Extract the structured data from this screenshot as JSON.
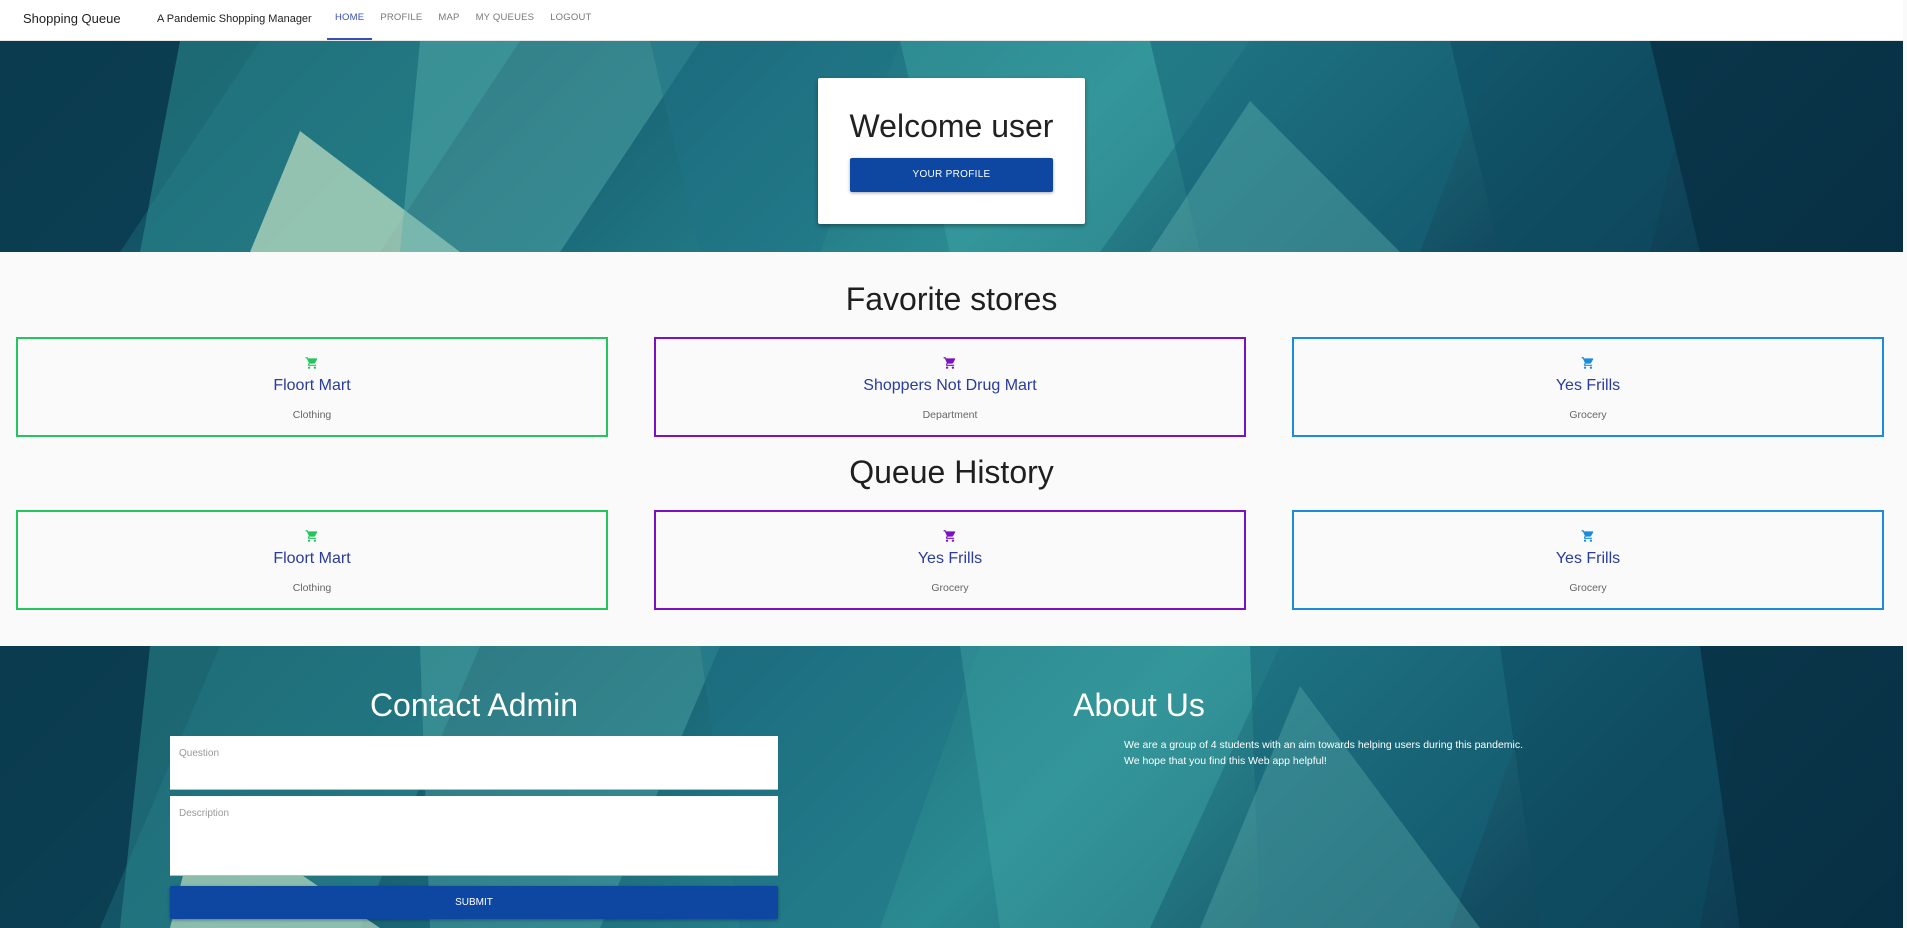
{
  "nav": {
    "brand": "Shopping Queue",
    "tagline": "A Pandemic Shopping Manager",
    "tabs": [
      {
        "label": "HOME",
        "active": true
      },
      {
        "label": "PROFILE",
        "active": false
      },
      {
        "label": "MAP",
        "active": false
      },
      {
        "label": "MY QUEUES",
        "active": false
      },
      {
        "label": "LOGOUT",
        "active": false
      }
    ]
  },
  "hero": {
    "welcome": "Welcome user",
    "profile_button": "YOUR PROFILE"
  },
  "favorites": {
    "title": "Favorite stores",
    "stores": [
      {
        "name": "Floort Mart",
        "category": "Clothing",
        "color": "#22c55e",
        "icon": "cart-icon"
      },
      {
        "name": "Shoppers Not Drug Mart",
        "category": "Department",
        "color": "#7a12c4",
        "icon": "cart-icon"
      },
      {
        "name": "Yes Frills",
        "category": "Grocery",
        "color": "#1a8cdb",
        "icon": "cart-icon"
      }
    ]
  },
  "history": {
    "title": "Queue History",
    "stores": [
      {
        "name": "Floort Mart",
        "category": "Clothing",
        "color": "#22c55e",
        "icon": "cart-icon"
      },
      {
        "name": "Yes Frills",
        "category": "Grocery",
        "color": "#7a12c4",
        "icon": "cart-icon"
      },
      {
        "name": "Yes Frills",
        "category": "Grocery",
        "color": "#1a8cdb",
        "icon": "cart-icon"
      }
    ]
  },
  "contact": {
    "title": "Contact Admin",
    "question_placeholder": "Question",
    "description_placeholder": "Description",
    "submit_label": "SUBMIT"
  },
  "about": {
    "title": "About Us",
    "line1": "We are a group of 4 students with an aim towards helping users during this pandemic.",
    "line2": "We hope that you find this Web app helpful!"
  },
  "colors": {
    "primary_button": "#0d47a1",
    "active_tab": "#3a4fb5",
    "store_name": "#2a3c9c"
  }
}
